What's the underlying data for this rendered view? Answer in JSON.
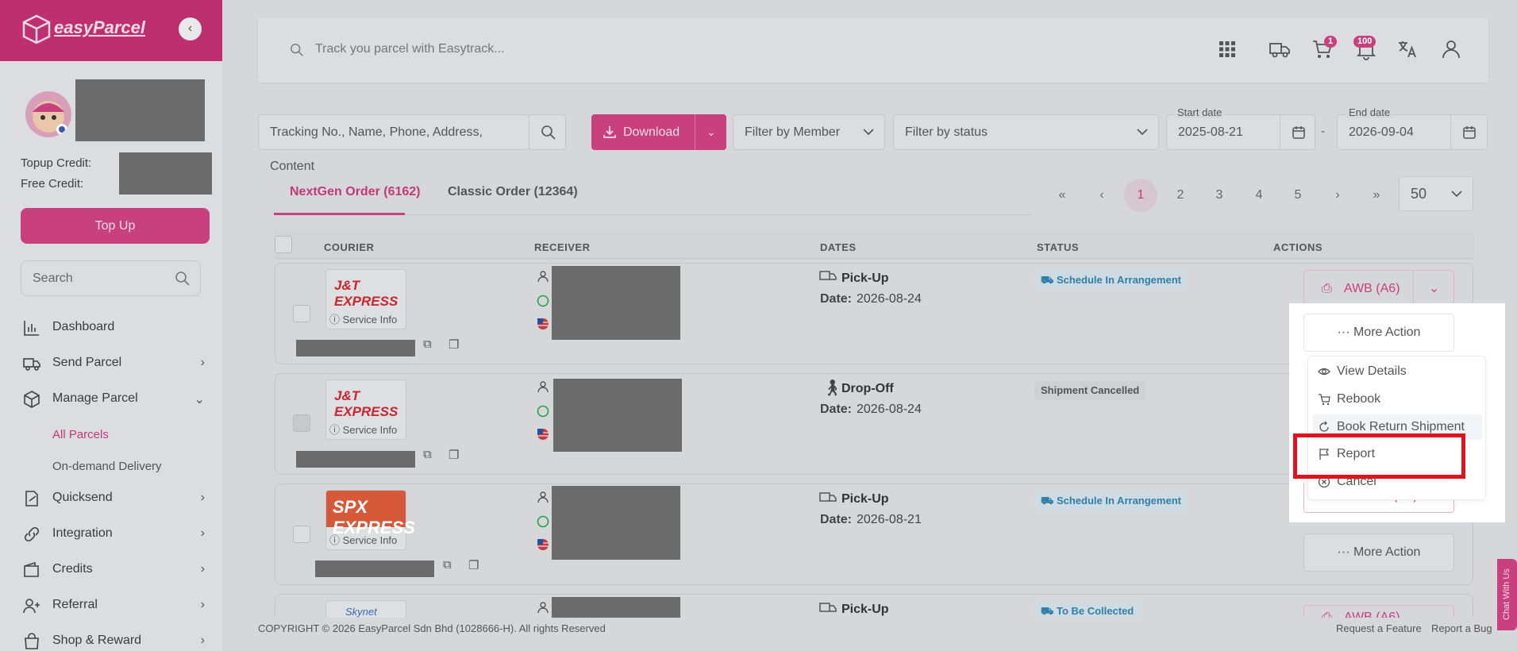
{
  "brand": {
    "name": "easyParcel"
  },
  "sidebar": {
    "topup_label": "Topup Credit:",
    "free_label": "Free Credit:",
    "topup_button": "Top Up",
    "search_placeholder": "Search",
    "items": [
      {
        "label": "Dashboard",
        "icon": "chart-bar-icon"
      },
      {
        "label": "Send Parcel",
        "icon": "truck-icon"
      },
      {
        "label": "Manage Parcel",
        "icon": "box-icon"
      },
      {
        "label": "Quicksend",
        "icon": "quicksend-icon"
      },
      {
        "label": "Integration",
        "icon": "link-icon"
      },
      {
        "label": "Credits",
        "icon": "wallet-icon"
      },
      {
        "label": "Referral",
        "icon": "user-plus-icon"
      },
      {
        "label": "Shop & Reward",
        "icon": "shopping-bag-icon"
      }
    ],
    "subitems": [
      {
        "label": "All Parcels",
        "active": true
      },
      {
        "label": "On-demand Delivery",
        "active": false
      }
    ]
  },
  "header": {
    "track_placeholder": "Track you parcel with Easytrack...",
    "cart_count": "1",
    "notif_count": "100"
  },
  "filters": {
    "search_placeholder": "Tracking No., Name, Phone, Address, Content",
    "download": "Download",
    "member": "Filter by Member",
    "status": "Filter by status",
    "start_caption": "Start date",
    "start_value": "2025-08-21",
    "end_caption": "End date",
    "end_value": "2026-09-04",
    "dash": "-"
  },
  "tabs": [
    {
      "label": "NextGen Order (6162)",
      "active": true
    },
    {
      "label": "Classic Order (12364)",
      "active": false
    }
  ],
  "pagination": {
    "first": "«",
    "prev": "‹",
    "pages": [
      "1",
      "2",
      "3",
      "4",
      "5"
    ],
    "next": "›",
    "last": "»",
    "per_page": "50"
  },
  "table": {
    "columns": [
      "COURIER",
      "RECEIVER",
      "DATES",
      "STATUS",
      "ACTIONS"
    ],
    "rows": [
      {
        "courier": "J&T EXPRESS",
        "service": "Service Info",
        "date_type": "Pick-Up",
        "date": "2026-08-24",
        "status": "Schedule In Arrangement",
        "status_style": "blue"
      },
      {
        "courier": "J&T EXPRESS",
        "service": "Service Info",
        "date_type": "Drop-Off",
        "date": "2026-08-24",
        "status": "Shipment Cancelled",
        "status_style": "grey"
      },
      {
        "courier": "SPX EXPRESS",
        "service": "Service Info",
        "date_type": "Pick-Up",
        "date": "2026-08-21",
        "status": "Schedule In Arrangement",
        "status_style": "blue"
      },
      {
        "courier": "Skynet",
        "service": "",
        "date_type": "Pick-Up",
        "date": "",
        "status": "To Be Collected",
        "status_style": "blue"
      }
    ],
    "date_prefix": "Date:",
    "awb": "AWB (A6)",
    "more_action": "More Action"
  },
  "menu": {
    "items": [
      "View Details",
      "Rebook",
      "Book Return Shipment",
      "Report",
      "Cancel"
    ],
    "highlighted": "Report"
  },
  "footer": {
    "copyright": "COPYRIGHT © 2026 EasyParcel Sdn Bhd (1028666-H). All rights Reserved",
    "request": "Request a Feature",
    "bug": "Report a Bug"
  },
  "chat": "Chat With Us",
  "colors": {
    "accent": "#c8407d",
    "highlight": "#e3131e"
  }
}
